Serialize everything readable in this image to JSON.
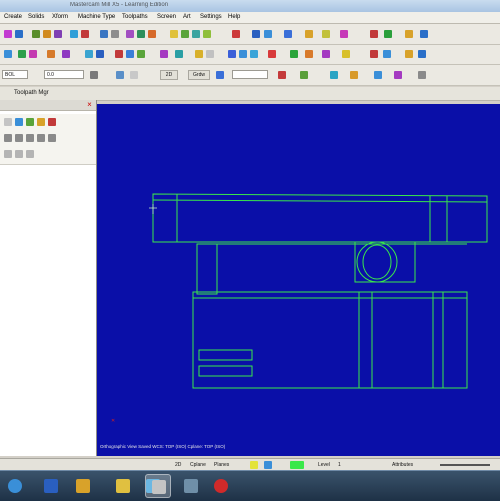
{
  "window": {
    "title": "Mastercam Mill X5 - Learning Edition"
  },
  "menu": [
    "Create",
    "Solids",
    "Xform",
    "Machine Type",
    "Toolpaths",
    "Screen",
    "Art",
    "Settings",
    "Help"
  ],
  "attributes_row": {
    "level_field": "BOL",
    "z_field": "0.0",
    "button_2d": "2D",
    "button_gview": "Grdw",
    "color_field": ""
  },
  "tab_strip": {
    "tab_label": "Toolpath Mgr"
  },
  "panel": {
    "close_glyph": "×"
  },
  "graphics": {
    "background_color": "#0a0fa8",
    "wire_color": "#39e84a",
    "status_text": "Orthographic View Saved   WCS: TOP (ISO)   Cplane: TOP (ISO)"
  },
  "statusbar": {
    "zoom_value": "2D",
    "cplane_label": "Cplane",
    "tplane_label": "Planes",
    "level_label": "Level",
    "level_value": "1",
    "attributes_label": "Attributes"
  },
  "taskbar": {
    "apps": [
      "start",
      "explorer",
      "media",
      "folder",
      "browser",
      "mastercam",
      "tool",
      "recorder"
    ]
  }
}
